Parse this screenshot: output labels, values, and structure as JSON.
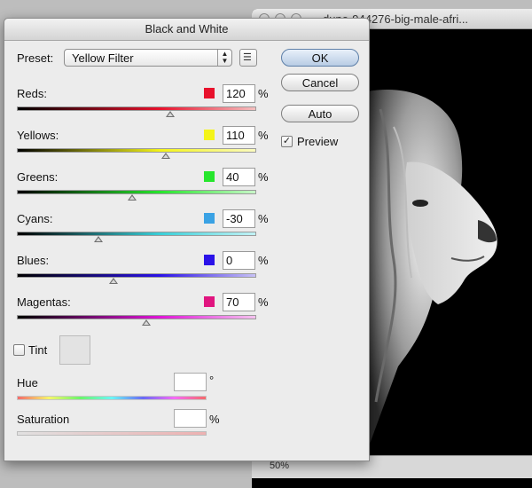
{
  "document_window": {
    "title": "dune-944276-big-male-afri...",
    "zoom": "50%"
  },
  "dialog": {
    "title": "Black and White",
    "preset_label": "Preset:",
    "preset_value": "Yellow Filter",
    "buttons": {
      "ok": "OK",
      "cancel": "Cancel",
      "auto": "Auto"
    },
    "preview_label": "Preview",
    "preview_checked": true,
    "channels": [
      {
        "label": "Reds:",
        "value": "120",
        "unit": "%",
        "color": "#e8112c"
      },
      {
        "label": "Yellows:",
        "value": "110",
        "unit": "%",
        "color": "#f4f419"
      },
      {
        "label": "Greens:",
        "value": "40",
        "unit": "%",
        "color": "#27e62d"
      },
      {
        "label": "Cyans:",
        "value": "-30",
        "unit": "%",
        "color": "#3aa2e4"
      },
      {
        "label": "Blues:",
        "value": "0",
        "unit": "%",
        "color": "#2a12e8"
      },
      {
        "label": "Magentas:",
        "value": "70",
        "unit": "%",
        "color": "#e0157f"
      }
    ],
    "tint": {
      "label": "Tint",
      "checked": false
    },
    "hue": {
      "label": "Hue",
      "unit": "°"
    },
    "saturation": {
      "label": "Saturation",
      "unit": "%"
    }
  }
}
